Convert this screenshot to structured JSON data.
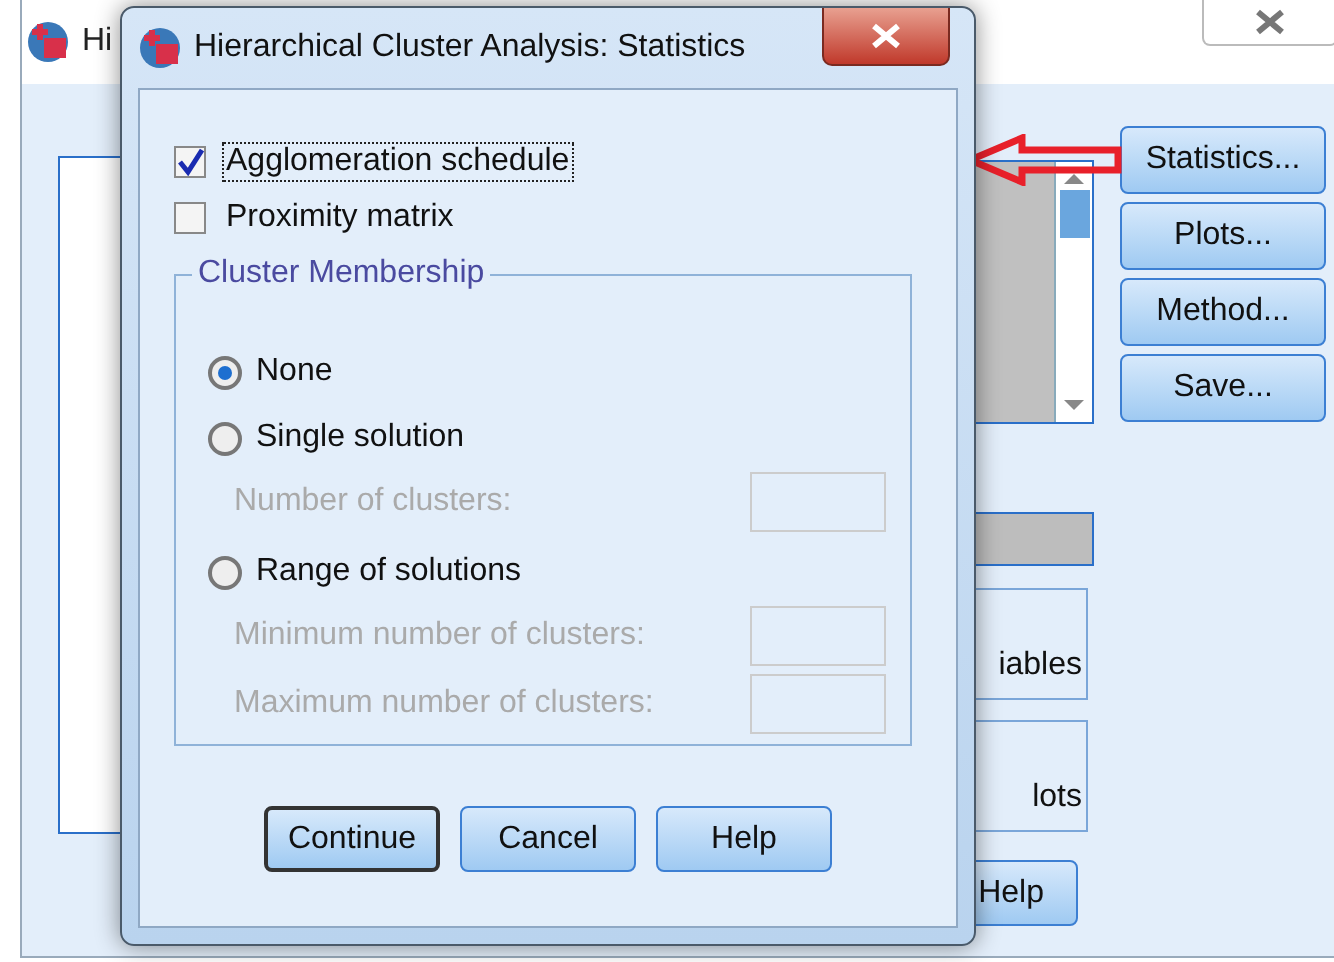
{
  "back_window": {
    "title": "Hi",
    "side_buttons": [
      {
        "label": "Statistics..."
      },
      {
        "label": "Plots..."
      },
      {
        "label": "Method..."
      },
      {
        "label": "Save..."
      }
    ],
    "lower_buttons": [
      {
        "label": "iables"
      },
      {
        "label": "lots"
      }
    ],
    "help_button": "Help"
  },
  "dialog": {
    "title": "Hierarchical Cluster Analysis: Statistics",
    "checkboxes": [
      {
        "label": "Agglomeration schedule",
        "checked": true,
        "focused": true
      },
      {
        "label": "Proximity matrix",
        "checked": false,
        "focused": false
      }
    ],
    "group": {
      "title": "Cluster Membership",
      "options": [
        {
          "label": "None",
          "selected": true
        },
        {
          "label": "Single solution",
          "selected": false,
          "fields": [
            {
              "label": "Number of clusters:",
              "disabled": true
            }
          ]
        },
        {
          "label": "Range of solutions",
          "selected": false,
          "fields": [
            {
              "label": "Minimum number of clusters:",
              "disabled": true
            },
            {
              "label": "Maximum number of clusters:",
              "disabled": true
            }
          ]
        }
      ]
    },
    "buttons": [
      {
        "label": "Continue",
        "default": true
      },
      {
        "label": "Cancel",
        "default": false
      },
      {
        "label": "Help",
        "default": false
      }
    ]
  }
}
